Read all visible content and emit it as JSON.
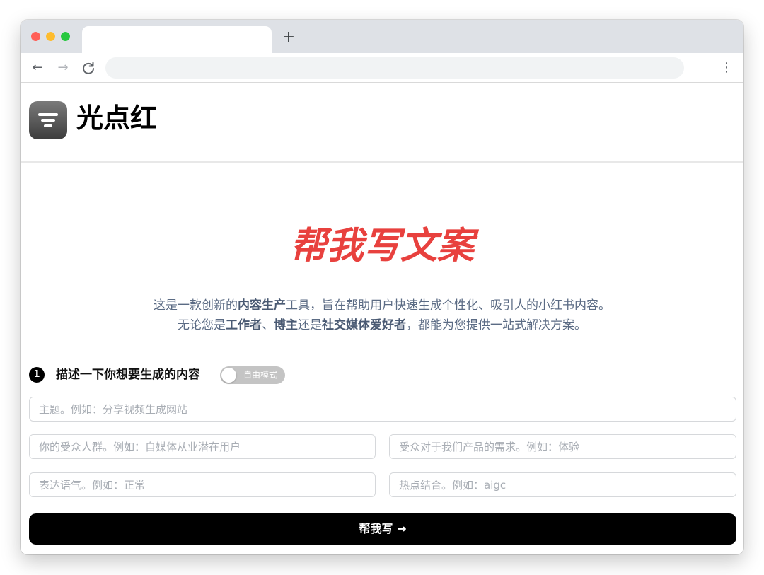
{
  "browser": {
    "new_tab_label": "+",
    "back_icon": "←",
    "forward_icon": "→",
    "reload_icon": "C",
    "menu_icon": "⋮"
  },
  "header": {
    "brand": "光点红"
  },
  "hero": {
    "title": "帮我写文案",
    "desc_line1": [
      {
        "text": "这是一款创新的",
        "bold": false
      },
      {
        "text": "内容生产",
        "bold": true
      },
      {
        "text": "工具，旨在帮助用户快速生成个性化、吸引人的小红书内容。",
        "bold": false
      }
    ],
    "desc_line2": [
      {
        "text": "无论您是",
        "bold": false
      },
      {
        "text": "工作者",
        "bold": true
      },
      {
        "text": "、",
        "bold": false
      },
      {
        "text": "博主",
        "bold": true
      },
      {
        "text": "还是",
        "bold": false
      },
      {
        "text": "社交媒体爱好者",
        "bold": true
      },
      {
        "text": "，都能为您提供一站式解决方案。",
        "bold": false
      }
    ]
  },
  "step1": {
    "number": "1",
    "label": "描述一下你想要生成的内容",
    "toggle_label": "自由模式",
    "toggle_on": false
  },
  "form": {
    "topic_placeholder": "主题。例如：分享视频生成网站",
    "audience_placeholder": "你的受众人群。例如：自媒体从业潜在用户",
    "need_placeholder": "受众对于我们产品的需求。例如：体验",
    "tone_placeholder": "表达语气。例如：正常",
    "hot_placeholder": "热点结合。例如：aigc",
    "submit_label": "帮我写 →"
  }
}
